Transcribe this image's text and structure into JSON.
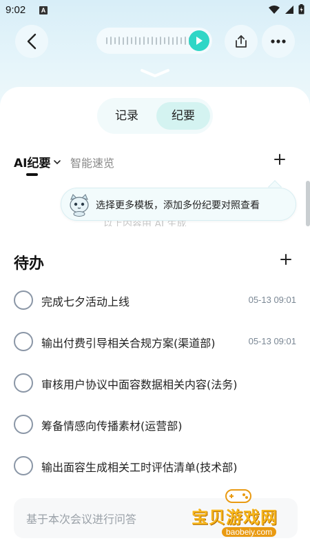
{
  "status_bar": {
    "time": "9:02",
    "notification_letter": "A"
  },
  "toolbar": {
    "back": "back",
    "share": "share",
    "more": "more"
  },
  "segmented": {
    "record_label": "记录",
    "summary_label": "纪要",
    "selected": "纪要"
  },
  "tabs": {
    "ai_summary": "AI纪要",
    "quick_view": "智能速览"
  },
  "tooltip": {
    "text": "选择更多模板，添加多份纪要对照查看"
  },
  "obscured_text": "以上内容由 AI 生成",
  "todo": {
    "title": "待办",
    "items": [
      {
        "text": "完成七夕活动上线",
        "time": "05-13 09:01"
      },
      {
        "text": "输出付费引导相关合规方案(渠道部)",
        "time": "05-13 09:01"
      },
      {
        "text": "审核用户协议中面容数据相关内容(法务)",
        "time": ""
      },
      {
        "text": "筹备情感向传播素材(运营部)",
        "time": ""
      },
      {
        "text": "输出面容生成相关工时评估清单(技术部)",
        "time": ""
      }
    ]
  },
  "qa": {
    "placeholder": "基于本次会议进行问答"
  },
  "watermark": {
    "main": "宝贝游戏网",
    "sub": "baobeiy.com"
  },
  "colors": {
    "accent": "#2fd6c6",
    "selected_segment": "#d4f3f1",
    "background_top": "#d8eef8"
  },
  "icons": {
    "back": "chevron-left-icon",
    "play": "play-icon",
    "share": "share-icon",
    "more": "more-dots-icon",
    "collapse": "chevron-down-icon",
    "add": "plus-icon",
    "dropdown": "caret-down-icon"
  }
}
